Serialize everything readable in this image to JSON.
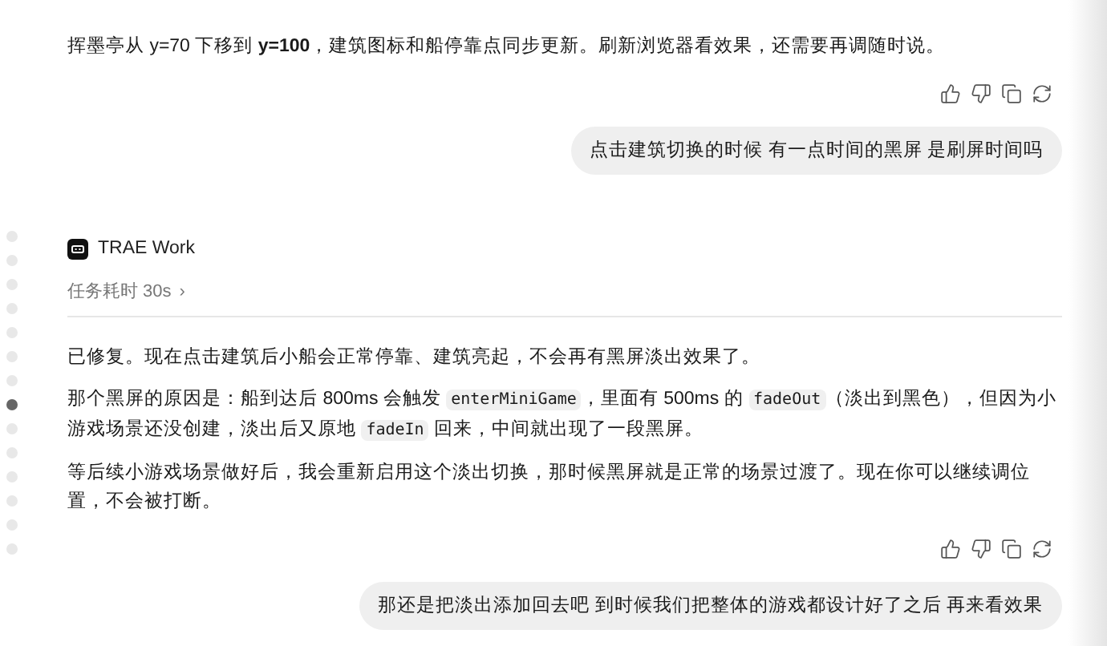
{
  "timeline": [
    {
      "selected": false
    },
    {
      "selected": false
    },
    {
      "selected": false
    },
    {
      "selected": false
    },
    {
      "selected": false
    },
    {
      "selected": false
    },
    {
      "selected": false
    },
    {
      "selected": true
    },
    {
      "selected": false
    },
    {
      "selected": false
    },
    {
      "selected": false
    },
    {
      "selected": false
    },
    {
      "selected": false
    },
    {
      "selected": false
    }
  ],
  "messages": [
    {
      "kind": "assistant",
      "paragraphs": [
        [
          {
            "kind": "text",
            "text": "挥墨亭从 y=70 下移到 "
          },
          {
            "kind": "bold",
            "text": "y=100"
          },
          {
            "kind": "text",
            "text": "，建筑图标和船停靠点同步更新。刷新浏览器看效果，还需要再调随时说。"
          }
        ]
      ]
    },
    {
      "kind": "user",
      "text": "点击建筑切换的时候 有一点时间的黑屏 是刷屏时间吗"
    },
    {
      "kind": "assistant",
      "agent": {
        "name": "TRAE Work",
        "duration": "任务耗时 30s",
        "chevron": "›"
      },
      "paragraphs": [
        [
          {
            "kind": "text",
            "text": "已修复。现在点击建筑后小船会正常停靠、建筑亮起，不会再有黑屏淡出效果了。"
          }
        ],
        [
          {
            "kind": "text",
            "text": "那个黑屏的原因是：船到达后 800ms 会触发 "
          },
          {
            "kind": "code",
            "text": "enterMiniGame"
          },
          {
            "kind": "text",
            "text": "，里面有 500ms 的 "
          },
          {
            "kind": "code",
            "text": "fadeOut"
          },
          {
            "kind": "text",
            "text": "（淡出到黑色），但因为小游戏场景还没创建，淡出后又原地 "
          },
          {
            "kind": "code",
            "text": "fadeIn"
          },
          {
            "kind": "text",
            "text": " 回来，中间就出现了一段黑屏。"
          }
        ],
        [
          {
            "kind": "text",
            "text": "等后续小游戏场景做好后，我会重新启用这个淡出切换，那时候黑屏就是正常的场景过渡了。现在你可以继续调位置，不会被打断。"
          }
        ]
      ]
    },
    {
      "kind": "user",
      "text": "那还是把淡出添加回去吧 到时候我们把整体的游戏都设计好了之后 再来看效果"
    }
  ]
}
